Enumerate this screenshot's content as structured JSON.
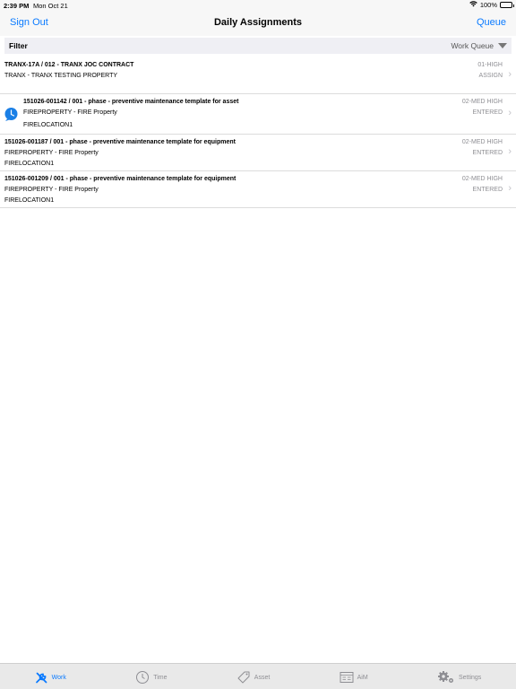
{
  "status_bar": {
    "time": "2:39 PM",
    "date": "Mon Oct 21",
    "battery": "100%",
    "wifi_icon": "wifi-icon",
    "battery_icon": "battery-icon"
  },
  "nav": {
    "left_button": "Sign Out",
    "title": "Daily Assignments",
    "right_button": "Queue"
  },
  "filter": {
    "label": "Filter",
    "value": "Work Queue"
  },
  "items": [
    {
      "line1": "TRANX-17A / 012 - TRANX JOC CONTRACT",
      "line2": "TRANX - TRANX TESTING PROPERTY",
      "line3": "",
      "priority": "01-HIGH",
      "status": "ASSIGN",
      "has_clock_icon": false
    },
    {
      "line1": "151026-001142 / 001 - phase - preventive maintenance template for asset",
      "line2": "FIREPROPERTY - FIRE Property",
      "line3": "FIRELOCATION1",
      "priority": "02-MED HIGH",
      "status": "ENTERED",
      "has_clock_icon": true
    },
    {
      "line1": "151026-001187 / 001 - phase - preventive maintenance template for equipment",
      "line2": "FIREPROPERTY - FIRE Property",
      "line3": "FIRELOCATION1",
      "priority": "02-MED HIGH",
      "status": "ENTERED",
      "has_clock_icon": false
    },
    {
      "line1": "151026-001209 / 001 - phase - preventive maintenance template for equipment",
      "line2": "FIREPROPERTY - FIRE Property",
      "line3": "FIRELOCATION1",
      "priority": "02-MED HIGH",
      "status": "ENTERED",
      "has_clock_icon": false
    }
  ],
  "tabs": [
    {
      "label": "Work",
      "icon": "wrench-icon",
      "active": true
    },
    {
      "label": "Time",
      "icon": "clock-icon",
      "active": false
    },
    {
      "label": "Asset",
      "icon": "tag-icon",
      "active": false
    },
    {
      "label": "AiM",
      "icon": "aim-icon",
      "active": false
    },
    {
      "label": "Settings",
      "icon": "gear-icon",
      "active": false
    }
  ],
  "colors": {
    "accent": "#0a7aff",
    "secondary_text": "#8e8e93",
    "bar_background": "#f7f7f7",
    "tab_bar_background": "#e9e9e9"
  }
}
